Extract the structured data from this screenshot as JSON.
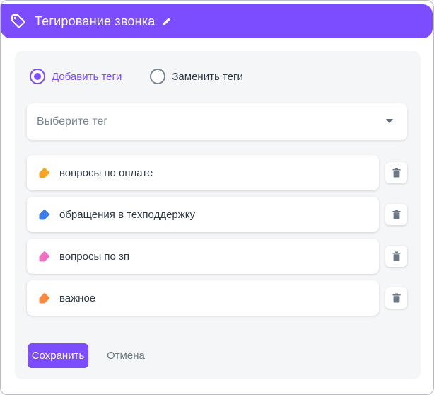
{
  "header": {
    "title": "Тегирование звонка",
    "icon": "tag-outline-icon",
    "edit_icon": "pencil-icon"
  },
  "mode": {
    "options": [
      {
        "label": "Добавить теги",
        "selected": true
      },
      {
        "label": "Заменить теги",
        "selected": false
      }
    ]
  },
  "select": {
    "placeholder": "Выберите тег",
    "icon": "chevron-down-icon"
  },
  "tags": [
    {
      "label": "вопросы по оплате",
      "color": "#f5a623"
    },
    {
      "label": "обращения в техподдержку",
      "color": "#3b7de9"
    },
    {
      "label": "вопросы по зп",
      "color": "#ee6fc3"
    },
    {
      "label": "важное",
      "color": "#ff8a3d"
    }
  ],
  "actions": {
    "save_label": "Сохранить",
    "cancel_label": "Отмена"
  },
  "colors": {
    "accent": "#7c4dff",
    "panel_bg": "#f5f6f8"
  }
}
